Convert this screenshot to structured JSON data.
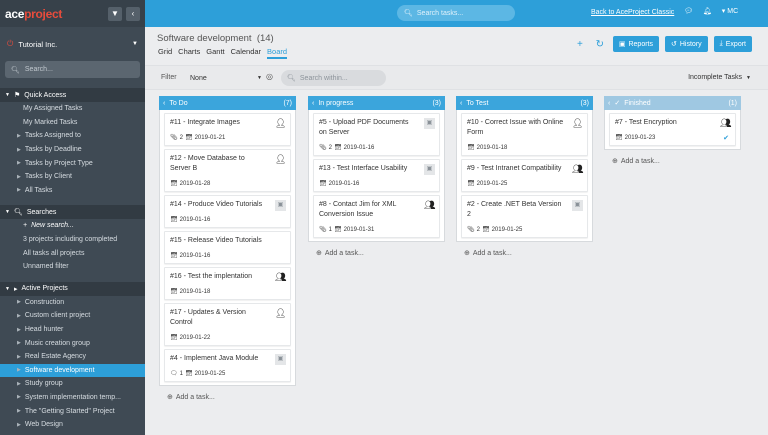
{
  "app": {
    "logo_a": "ace",
    "logo_b": "project"
  },
  "sidebar": {
    "org": "Tutorial Inc.",
    "search_placeholder": "Search...",
    "sections": [
      {
        "title": "Quick Access",
        "items": [
          "My Assigned Tasks",
          "My Marked Tasks",
          "Tasks Assigned to",
          "Tasks by Deadline",
          "Tasks by Project Type",
          "Tasks by Client",
          "All Tasks"
        ]
      },
      {
        "title": "Searches",
        "items": [
          "New search...",
          "3 projects including completed",
          "All tasks all projects",
          "Unnamed filter"
        ]
      },
      {
        "title": "Active Projects",
        "items": [
          "Construction",
          "Custom client project",
          "Head hunter",
          "Music creation group",
          "Real Estate Agency",
          "Software development",
          "Study group",
          "System implementation temp...",
          "The \"Getting Started\" Project",
          "Web Design"
        ]
      }
    ]
  },
  "topbar": {
    "search_placeholder": "Search tasks...",
    "back_link": "Back to AceProject Classic",
    "user": "MC"
  },
  "main": {
    "title": "Software development",
    "count": "(14)",
    "views": [
      "Grid",
      "Charts",
      "Gantt",
      "Calendar",
      "Board"
    ],
    "buttons": {
      "reports": "Reports",
      "history": "History",
      "export": "Export"
    }
  },
  "filter": {
    "label": "Filter",
    "value": "None",
    "search_placeholder": "Search within...",
    "status": "Incomplete Tasks"
  },
  "columns": [
    {
      "title": "To Do",
      "count": "(7)",
      "cards": [
        {
          "title": "#11 - Integrate Images",
          "meta": "2",
          "date": "2019-01-21",
          "avatar": "person"
        },
        {
          "title": "#12 - Move Database to Server B",
          "meta": "",
          "date": "2019-01-28",
          "avatar": "person"
        },
        {
          "title": "#14 - Produce Video Tutorials",
          "meta": "",
          "date": "2019-01-16",
          "avatar": "placeholder"
        },
        {
          "title": "#15 - Release Video Tutorials",
          "meta": "",
          "date": "2019-01-16",
          "avatar": ""
        },
        {
          "title": "#16 - Test the implentation",
          "meta": "",
          "date": "2019-01-18",
          "avatar": "group"
        },
        {
          "title": "#17 - Updates & Version Control",
          "meta": "",
          "date": "2019-01-22",
          "avatar": "person"
        },
        {
          "title": "#4 - Implement Java Module",
          "meta": "1",
          "date": "2019-01-25",
          "avatar": "placeholder"
        }
      ],
      "add": "Add a task..."
    },
    {
      "title": "In progress",
      "count": "(3)",
      "cards": [
        {
          "title": "#5 - Upload PDF Documents on Server",
          "meta": "2",
          "date": "2019-01-16",
          "avatar": "placeholder"
        },
        {
          "title": "#13 - Test Interface Usability",
          "meta": "",
          "date": "2019-01-16",
          "avatar": "placeholder"
        },
        {
          "title": "#8 - Contact Jim for XML Conversion Issue",
          "meta": "1",
          "date": "2019-01-31",
          "avatar": "group"
        }
      ],
      "add": "Add a task..."
    },
    {
      "title": "To Test",
      "count": "(3)",
      "cards": [
        {
          "title": "#10 - Correct Issue with Online Form",
          "meta": "",
          "date": "2019-01-18",
          "avatar": "person"
        },
        {
          "title": "#9 - Test Intranet Compatibility",
          "meta": "",
          "date": "2019-01-25",
          "avatar": "group"
        },
        {
          "title": "#2 - Create .NET Beta Version 2",
          "meta": "2",
          "date": "2019-01-25",
          "avatar": "placeholder"
        }
      ],
      "add": "Add a task..."
    },
    {
      "title": "Finished",
      "count": "(1)",
      "cards": [
        {
          "title": "#7 - Test Encryption",
          "meta": "",
          "date": "2019-01-23",
          "avatar": "group",
          "done": true
        }
      ],
      "add": "Add a task..."
    }
  ]
}
